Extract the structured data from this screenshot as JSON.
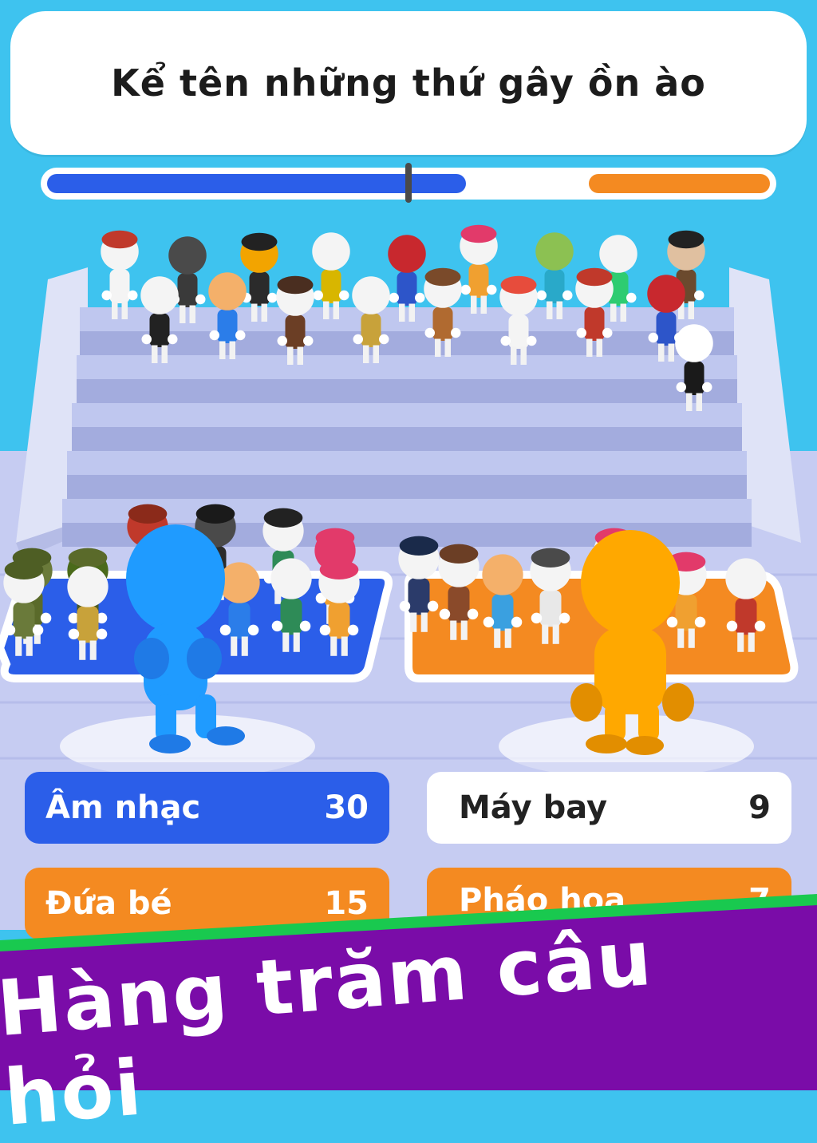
{
  "question": "Kể tên những thứ gây ồn ào",
  "progress": {
    "blue_share": 0.5,
    "orange_share": 0.25
  },
  "answers": [
    {
      "label": "Âm nhạc",
      "count": "30",
      "team": "blue"
    },
    {
      "label": "Máy bay",
      "count": "9",
      "team": "none"
    },
    {
      "label": "Đứa bé",
      "count": "15",
      "team": "orange"
    },
    {
      "label": "Pháo hoa",
      "count": "7",
      "team": "orange"
    }
  ],
  "banner": {
    "text": "Hàng trăm câu hỏi",
    "color": "#7a0ca8",
    "stripe_color": "#19c94f"
  },
  "colors": {
    "sky": "#3ec3ef",
    "blue_team": "#2b5ee9",
    "orange_team": "#f48a21",
    "stairs": "#aab3e6"
  },
  "players": [
    {
      "name": "blue-player",
      "color": "#1f9bff"
    },
    {
      "name": "orange-player",
      "color": "#ffa800"
    }
  ]
}
